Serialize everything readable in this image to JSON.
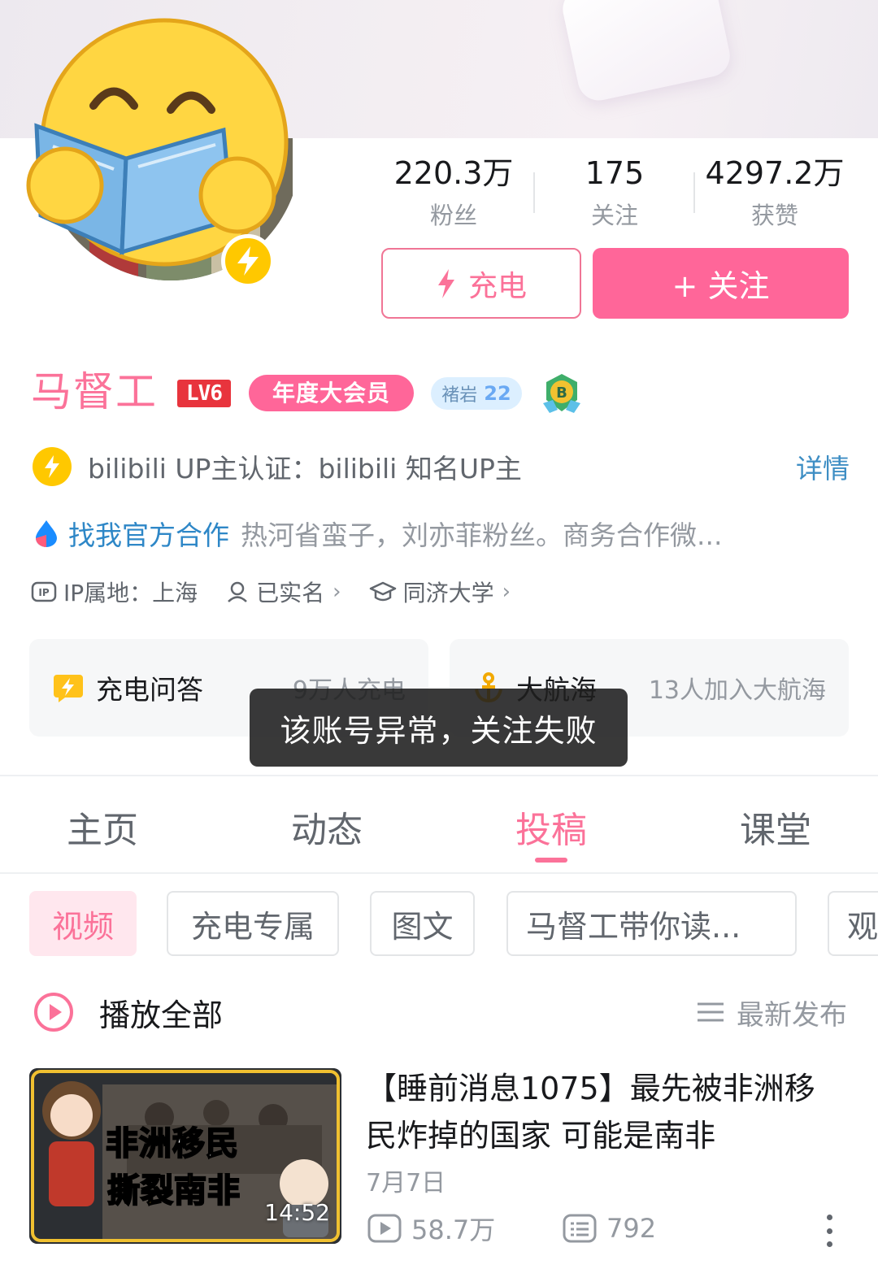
{
  "profile": {
    "name": "马督工",
    "level": "LV6",
    "vip_label": "年度大会员",
    "medal_name": "褚岩",
    "medal_level": "22"
  },
  "stats": [
    {
      "value": "220.3万",
      "label": "粉丝"
    },
    {
      "value": "175",
      "label": "关注"
    },
    {
      "value": "4297.2万",
      "label": "获赞"
    }
  ],
  "actions": {
    "charge_label": "充电",
    "follow_label": "+ 关注"
  },
  "verification": {
    "text": "bilibili UP主认证：bilibili 知名UP主",
    "detail_label": "详情"
  },
  "cooperation": {
    "link_label": "找我官方合作",
    "description": "热河省蛮子，刘亦菲粉丝。商务合作微..."
  },
  "meta": {
    "ip_label": "IP属地：上海",
    "realname_label": "已实名",
    "school_label": "同济大学"
  },
  "cards": {
    "qa_title": "充电问答",
    "qa_sub": "9万人充电",
    "fleet_title": "大航海",
    "fleet_sub": "13人加入大航海"
  },
  "toast": "该账号异常，关注失败",
  "tabs": [
    {
      "label": "主页"
    },
    {
      "label": "动态"
    },
    {
      "label": "投稿"
    },
    {
      "label": "课堂"
    }
  ],
  "active_tab": "投稿",
  "chips": [
    {
      "label": "视频"
    },
    {
      "label": "充电专属"
    },
    {
      "label": "图文"
    },
    {
      "label": "马督工带你读..."
    },
    {
      "label": "观"
    }
  ],
  "list_header": {
    "play_all": "播放全部",
    "sort_label": "最新发布"
  },
  "video": {
    "title": "【睡前消息1075】最先被非洲移民炸掉的国家 可能是南非",
    "thumb_line1": "非洲移民",
    "thumb_line2": "撕裂南非",
    "duration": "14:52",
    "date": "7月7日",
    "views": "58.7万",
    "comments": "792"
  },
  "colors": {
    "accent": "#fb7299",
    "follow_bg": "#ff6699",
    "link_blue": "#2e87c7",
    "level_red": "#e8343d",
    "lightning": "#ffc800"
  },
  "icons": {
    "charge": "lightning-icon",
    "verify": "lightning-badge-icon",
    "cooperation": "droplet-logo-icon",
    "ip": "ip-tag-icon",
    "realname": "person-icon",
    "school": "graduation-cap-icon",
    "qa": "lightning-chat-icon",
    "fleet": "anchor-icon",
    "play_all": "play-circle-icon",
    "sort": "list-icon",
    "views": "play-box-icon",
    "comments": "comment-box-icon",
    "more": "more-vertical-icon"
  }
}
